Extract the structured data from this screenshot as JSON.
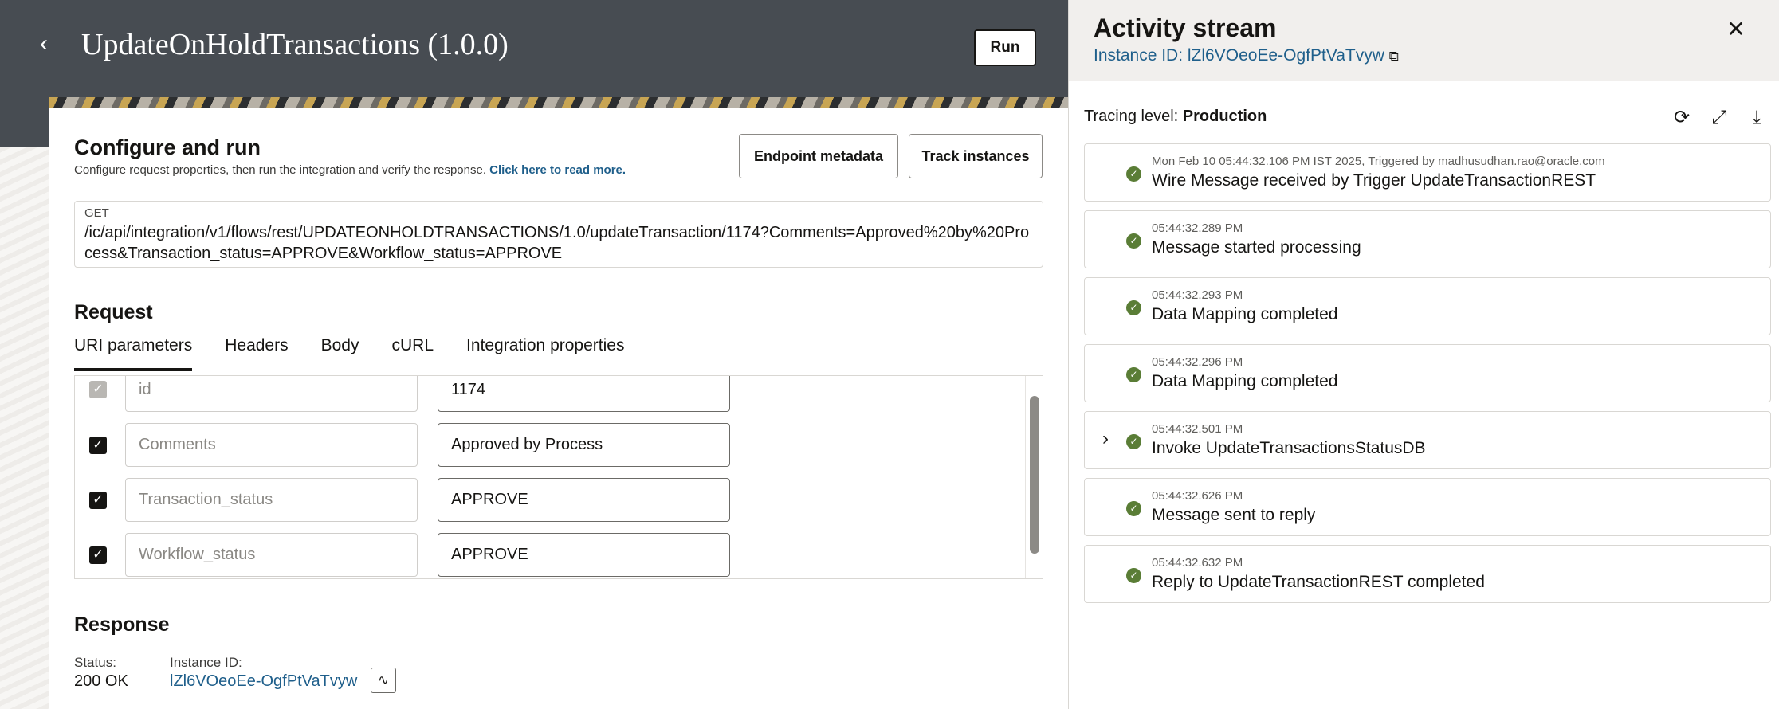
{
  "header": {
    "title": "UpdateOnHoldTransactions (1.0.0)",
    "run_label": "Run",
    "back_icon": "chevron-left-icon"
  },
  "configure": {
    "title": "Configure and run",
    "subtitle": "Configure request properties, then run the integration and verify the response.",
    "read_more": "Click here to read more.",
    "endpoint_metadata": "Endpoint metadata",
    "track_instances": "Track instances",
    "method": "GET",
    "url": "/ic/api/integration/v1/flows/rest/UPDATEONHOLDTRANSACTIONS/1.0/updateTransaction/1174?Comments=Approved%20by%20Process&Transaction_status=APPROVE&Workflow_status=APPROVE"
  },
  "request": {
    "title": "Request",
    "tabs": [
      {
        "label": "URI parameters"
      },
      {
        "label": "Headers"
      },
      {
        "label": "Body"
      },
      {
        "label": "cURL"
      },
      {
        "label": "Integration properties"
      }
    ],
    "params": [
      {
        "name": "id",
        "value": "1174",
        "checked": true,
        "disabled": true
      },
      {
        "name": "Comments",
        "value": "Approved by Process",
        "checked": true,
        "disabled": false
      },
      {
        "name": "Transaction_status",
        "value": "APPROVE",
        "checked": true,
        "disabled": false
      },
      {
        "name": "Workflow_status",
        "value": "APPROVE",
        "checked": true,
        "disabled": false
      }
    ]
  },
  "response": {
    "title": "Response",
    "status_label": "Status:",
    "status_value": "200 OK",
    "instance_label": "Instance ID:",
    "instance_value": "lZl6VOeoEe-OgfPtVaTvyw"
  },
  "activity": {
    "title": "Activity stream",
    "instance_id": "Instance ID: lZl6VOeoEe-OgfPtVaTvyw",
    "tracing_label": "Tracing level:",
    "tracing_value": "Production",
    "events": [
      {
        "time": "Mon Feb 10 05:44:32.106 PM IST 2025, Triggered by madhusudhan.rao@oracle.com",
        "message": "Wire Message received by Trigger UpdateTransactionREST",
        "expandable": false
      },
      {
        "time": "05:44:32.289 PM",
        "message": "Message started processing",
        "expandable": false
      },
      {
        "time": "05:44:32.293 PM",
        "message": "Data Mapping completed",
        "expandable": false
      },
      {
        "time": "05:44:32.296 PM",
        "message": "Data Mapping completed",
        "expandable": false
      },
      {
        "time": "05:44:32.501 PM",
        "message": "Invoke UpdateTransactionsStatusDB",
        "expandable": true
      },
      {
        "time": "05:44:32.626 PM",
        "message": "Message sent to reply",
        "expandable": false
      },
      {
        "time": "05:44:32.632 PM",
        "message": "Reply to UpdateTransactionREST completed",
        "expandable": false
      }
    ]
  }
}
